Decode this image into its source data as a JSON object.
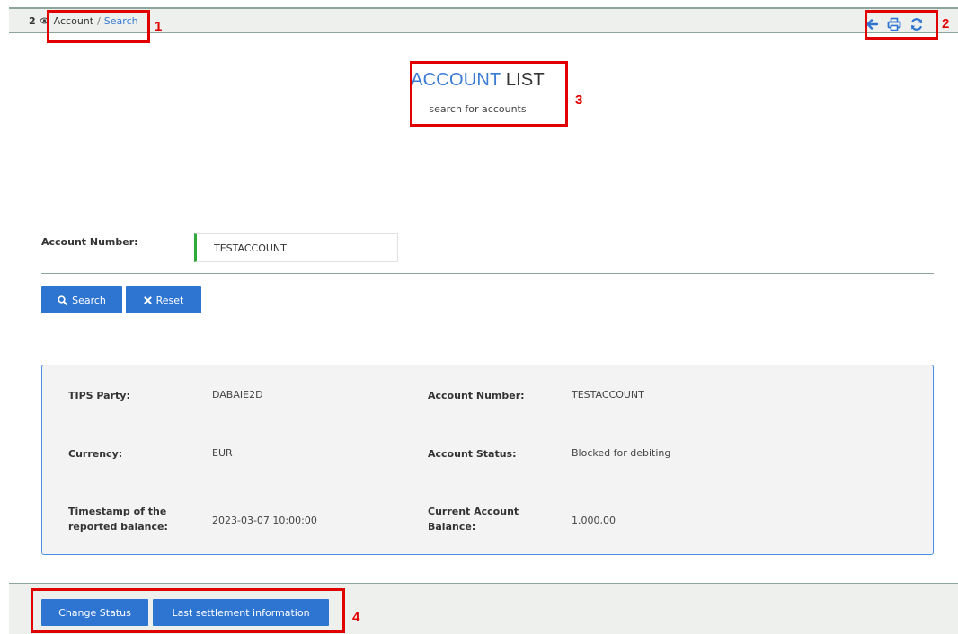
{
  "breadcrumb": {
    "count": "2",
    "parent": "Account",
    "separator": "/",
    "current": "Search"
  },
  "toolbar_icons": [
    "arrow-left-icon",
    "print-icon",
    "refresh-icon"
  ],
  "header": {
    "title_part1": "ACCOUNT",
    "title_part2": "LIST",
    "subtitle": "search for accounts"
  },
  "form": {
    "account_number_label": "Account Number:",
    "account_number_value": "TESTACCOUNT"
  },
  "buttons": {
    "search": "Search",
    "reset": "Reset",
    "change_status": "Change Status",
    "last_settlement": "Last settlement information"
  },
  "result": {
    "tips_party_label": "TIPS Party:",
    "tips_party_value": "DABAIE2D",
    "account_number_label": "Account Number:",
    "account_number_value": "TESTACCOUNT",
    "currency_label": "Currency:",
    "currency_value": "EUR",
    "account_status_label": "Account Status:",
    "account_status_value": "Blocked for debiting",
    "timestamp_label_l1": "Timestamp of the",
    "timestamp_label_l2": "reported balance:",
    "timestamp_value": "2023-03-07 10:00:00",
    "balance_label_l1": "Current Account",
    "balance_label_l2": "Balance:",
    "balance_value": "1.000,00"
  },
  "annotations": [
    "1",
    "2",
    "3",
    "4"
  ],
  "colors": {
    "accent": "#2e74d1",
    "link": "#3a7bd5",
    "annotation": "#e10000",
    "valid_field": "#2eaa3a"
  }
}
